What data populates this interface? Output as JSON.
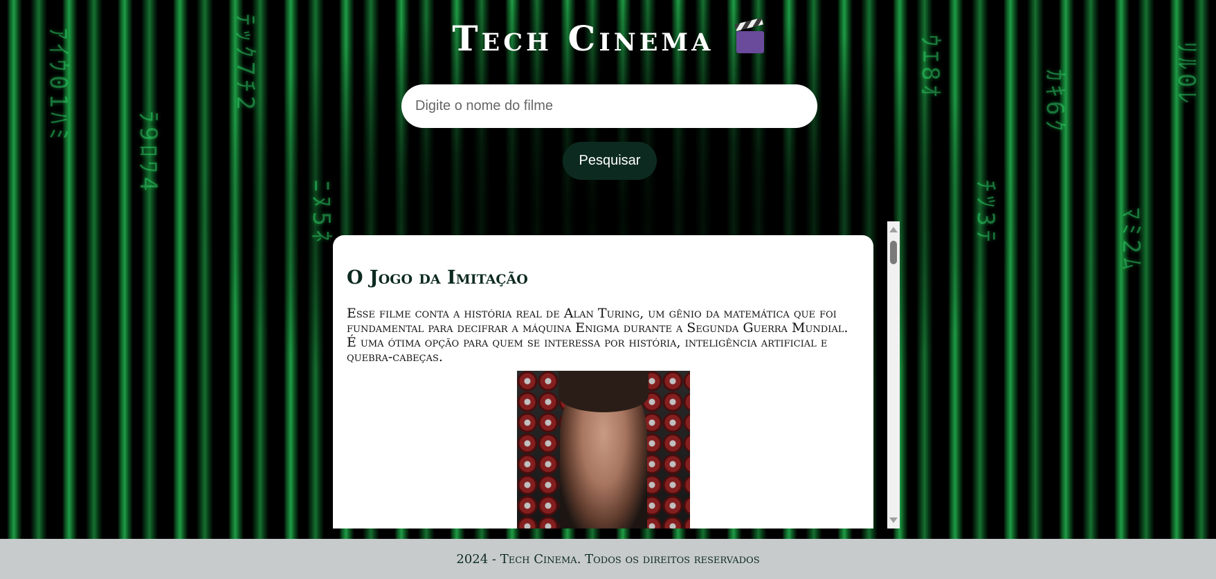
{
  "header": {
    "title": "Tech Cinema",
    "icon": "clapperboard-icon"
  },
  "search": {
    "placeholder": "Digite o nome do filme",
    "value": "",
    "button_label": "Pesquisar"
  },
  "result": {
    "title": "O Jogo da Imitação",
    "description": "Esse filme conta a história real de Alan Turing, um gênio da matemática que foi fundamental para decifrar a máquina Enigma durante a Segunda Guerra Mundial. É uma ótima opção para quem se interessa por história, inteligência artificial e quebra-cabeças.",
    "poster": "movie-poster"
  },
  "footer": {
    "text": "2024 - Tech Cinema. Todos os direitos reservados"
  },
  "colors": {
    "accent": "#0d2a20",
    "background_green": "#2fd66a",
    "footer_bg": "#c7cbcb"
  }
}
